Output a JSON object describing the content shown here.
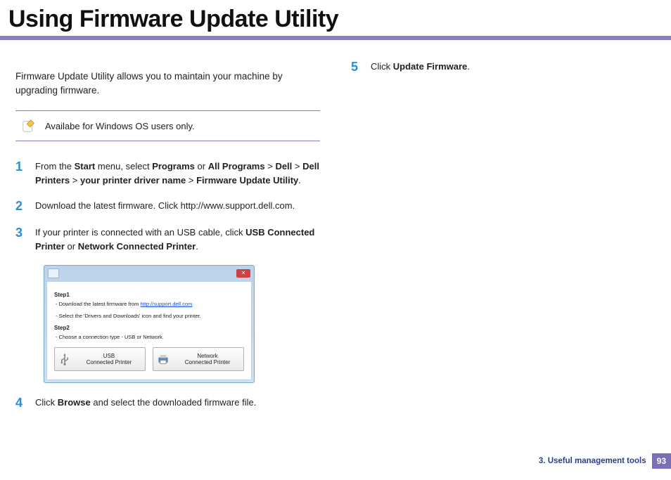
{
  "title": "Using Firmware Update Utility",
  "intro": "Firmware Update Utility allows you to maintain your machine by upgrading firmware.",
  "note": "Availabe for Windows OS users only.",
  "steps_left": {
    "s1": {
      "num": "1",
      "prefix": "From the ",
      "b1": "Start",
      "t1": " menu, select ",
      "b2": "Programs",
      "t2": " or ",
      "b3": "All Programs",
      "t3": " > ",
      "b4": "Dell",
      "t4": " > ",
      "b5": "Dell Printers",
      "t5": " > ",
      "b6": "your printer driver name",
      "t6": " > ",
      "b7": "Firmware Update Utility",
      "t7": "."
    },
    "s2": {
      "num": "2",
      "text": "Download the latest firmware. Click http://www.support.dell.com."
    },
    "s3": {
      "num": "3",
      "prefix": "If your printer is connected with an USB cable, click ",
      "b1": "USB Connected Printer",
      "mid": " or ",
      "b2": "Network Connected Printer",
      "suffix": "."
    },
    "s4": {
      "num": "4",
      "prefix": "Click ",
      "b1": "Browse",
      "suffix": " and select the downloaded firmware file."
    }
  },
  "steps_right": {
    "s5": {
      "num": "5",
      "prefix": "Click ",
      "b1": "Update Firmware",
      "suffix": "."
    }
  },
  "dialog": {
    "step1": "Step1",
    "line1a": "- Download the latest firmware from ",
    "line1link": "http://support.dell.com",
    "line1b": "- Select the 'Drivers and Downloads' icon and find your printer.",
    "step2": "Step2",
    "line2": "- Choose a connection type - USB or Network.",
    "btn_usb": "USB\nConnected Printer",
    "btn_net": "Network\nConnected Printer"
  },
  "footer": {
    "chapter": "3.  Useful management tools",
    "page": "93"
  }
}
